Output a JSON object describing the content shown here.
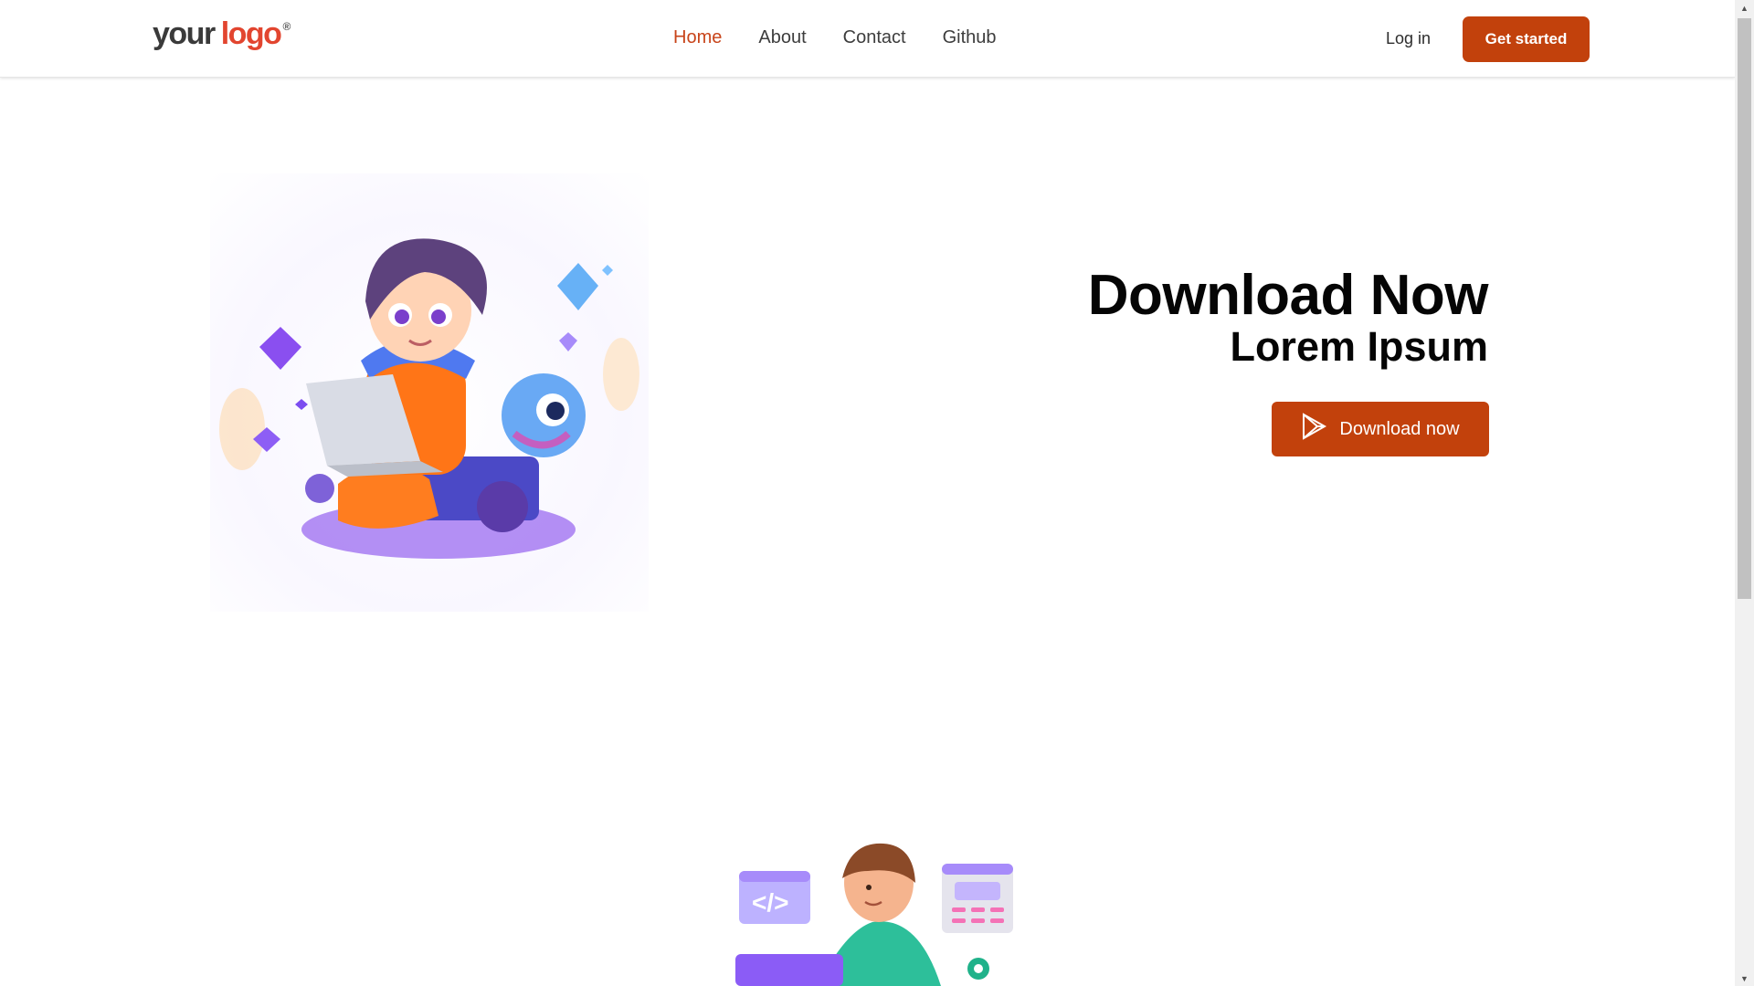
{
  "logo": {
    "your": "your",
    "mark": "logo",
    "reg": "®"
  },
  "nav": {
    "links": [
      {
        "label": "Home",
        "active": true
      },
      {
        "label": "About",
        "active": false
      },
      {
        "label": "Contact",
        "active": false
      },
      {
        "label": "Github",
        "active": false
      }
    ],
    "login": "Log in",
    "get_started": "Get started"
  },
  "hero": {
    "title": "Download Now",
    "subtitle": "Lorem Ipsum",
    "button": "Download now",
    "button_icon": "play-store-icon"
  },
  "colors": {
    "accent": "#c2410c",
    "active_link": "#c8441a",
    "logo_accent": "#e2452f"
  }
}
